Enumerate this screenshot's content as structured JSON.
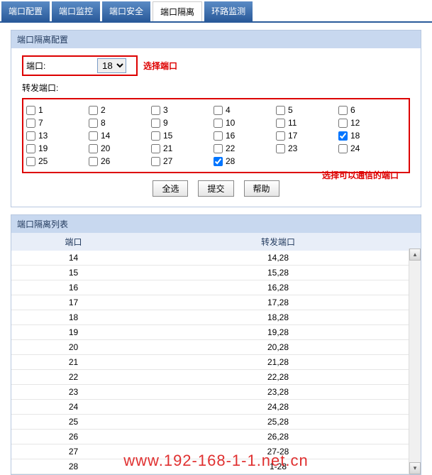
{
  "tabs": [
    "端口配置",
    "端口监控",
    "端口安全",
    "端口隔离",
    "环路监测"
  ],
  "active_tab": 3,
  "config": {
    "title": "端口隔离配置",
    "port_label": "端口:",
    "port_value": "18",
    "annotation_port": "选择端口",
    "forward_label": "转发端口:",
    "checkbox_count": 28,
    "checked": [
      18,
      28
    ],
    "annotation_forward": "选择可以通信的端口"
  },
  "buttons": {
    "select_all": "全选",
    "submit": "提交",
    "help": "帮助"
  },
  "list": {
    "title": "端口隔离列表",
    "col_port": "端口",
    "col_forward": "转发端口",
    "rows": [
      {
        "port": "14",
        "forward": "14,28"
      },
      {
        "port": "15",
        "forward": "15,28"
      },
      {
        "port": "16",
        "forward": "16,28"
      },
      {
        "port": "17",
        "forward": "17,28"
      },
      {
        "port": "18",
        "forward": "18,28"
      },
      {
        "port": "19",
        "forward": "19,28"
      },
      {
        "port": "20",
        "forward": "20,28"
      },
      {
        "port": "21",
        "forward": "21,28"
      },
      {
        "port": "22",
        "forward": "22,28"
      },
      {
        "port": "23",
        "forward": "23,28"
      },
      {
        "port": "24",
        "forward": "24,28"
      },
      {
        "port": "25",
        "forward": "25,28"
      },
      {
        "port": "26",
        "forward": "26,28"
      },
      {
        "port": "27",
        "forward": "27-28"
      },
      {
        "port": "28",
        "forward": "1-28"
      }
    ]
  },
  "watermark": "www.192-168-1-1.net.cn"
}
